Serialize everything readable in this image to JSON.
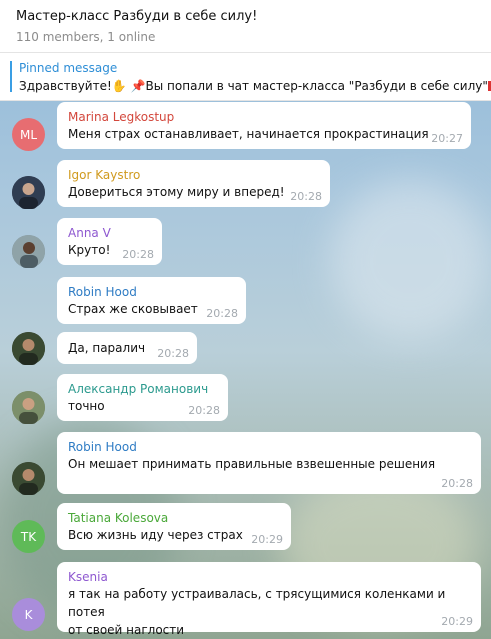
{
  "header": {
    "title": "Мастер-класс Разбуди в себе силу!",
    "subtitle": "110 members, 1 online"
  },
  "pinned": {
    "label": "Pinned message",
    "text_part1": "Здравствуйте!",
    "hand_icon": "✋",
    "pin_icon": "📌",
    "text_part2": "Вы попали в чат мастер-класса \"Разбуди в себе силу\"!"
  },
  "colors": {
    "accent": "#3a9ee4",
    "name_red": "#d3473c",
    "name_orange": "#d09a1e",
    "name_purple": "#8e58d0",
    "name_blue": "#2f7cc4",
    "name_teal": "#2c9a8e",
    "name_green": "#4aa839",
    "avatar_ml": "#e76d71",
    "avatar_tk": "#5fba58",
    "avatar_k": "#a98ddb"
  },
  "messages": [
    {
      "author": "Marina Legkostup",
      "text": "Меня страх останавливает, начинается прокрастинация",
      "time": "20:27",
      "avatar": "ML"
    },
    {
      "author": "Igor Kaystro",
      "text": "Довериться этому миру и вперед!",
      "time": "20:28",
      "avatar": "photo"
    },
    {
      "author": "Anna V",
      "text": "Круто!",
      "time": "20:28",
      "avatar": "photo"
    },
    {
      "author": "Robin Hood",
      "text": "Страх же сковывает",
      "time": "20:28",
      "avatar": ""
    },
    {
      "author": "",
      "text": "Да, паралич",
      "time": "20:28",
      "avatar": "photo"
    },
    {
      "author": "Александр Романович",
      "text": "точно",
      "time": "20:28",
      "avatar": "photo"
    },
    {
      "author": "Robin Hood",
      "text": "Он мешает принимать правильные взвешенные решения",
      "time": "20:28",
      "avatar": "photo"
    },
    {
      "author": "Tatiana Kolesova",
      "text": "Всю жизнь иду через страх",
      "time": "20:29",
      "avatar": "TK"
    },
    {
      "author": "Ksenia",
      "text_line1": "я так на работу устраивалась, с трясущимися коленками и потея",
      "text_line2": "от своей наглости",
      "time": "20:29",
      "avatar": "K"
    }
  ]
}
